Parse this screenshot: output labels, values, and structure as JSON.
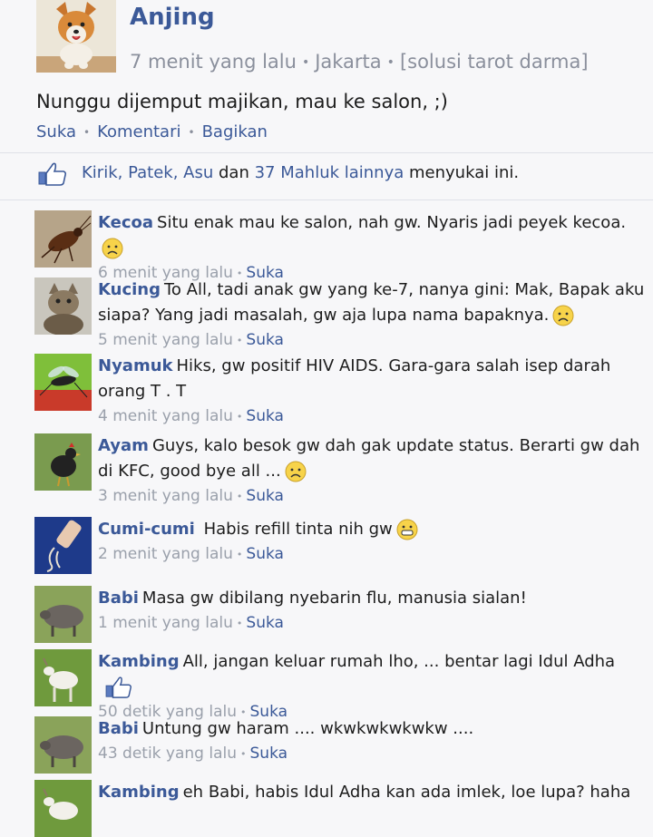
{
  "post": {
    "author": "Anjing",
    "time": "7 menit yang lalu",
    "location": "Jakarta",
    "source": "[solusi tarot darma]",
    "text": "Nunggu dijemput majikan, mau ke salon, ;)",
    "actions": [
      "Suka",
      "Komentari",
      "Bagikan"
    ]
  },
  "likes": {
    "names": "Kirik, Patek, Asu",
    "and": "dan",
    "others": "37 Mahluk lainnya",
    "suffix": "menyukai ini."
  },
  "comments": [
    {
      "name": "Kecoa",
      "text": "Situ enak mau ke salon, nah gw. Nyaris jadi peyek kecoa.",
      "time": "6 menit yang lalu",
      "like": "Suka",
      "emoji": "sad-emoji",
      "avatar": "cockroach-photo"
    },
    {
      "name": "Kucing",
      "text": "To All, tadi anak gw yang ke-7, nanya gini: Mak, Bapak aku siapa? Yang jadi masalah, gw aja lupa nama bapaknya.",
      "time": "5 menit yang lalu",
      "like": "Suka",
      "emoji": "sad-emoji",
      "avatar": "cat-photo"
    },
    {
      "name": "Nyamuk",
      "text": "Hiks, gw positif HIV AIDS. Gara-gara salah isep darah orang T . T",
      "time": "4 menit yang lalu",
      "like": "Suka",
      "emoji": "",
      "avatar": "mosquito-photo"
    },
    {
      "name": "Ayam",
      "text": "Guys, kalo besok gw dah gak update status. Berarti gw dah di KFC, good bye all ...",
      "time": "3 menit yang lalu",
      "like": "Suka",
      "emoji": "sad-emoji",
      "avatar": "chicken-photo"
    },
    {
      "name": "Cumi-cumi",
      "text": " Habis refill tinta nih gw",
      "time": "2 menit yang lalu",
      "like": "Suka",
      "emoji": "grin-emoji",
      "avatar": "squid-photo"
    },
    {
      "name": "Babi",
      "text": "Masa gw dibilang nyebarin flu, manusia sialan!",
      "time": "1 menit yang lalu",
      "like": "Suka",
      "emoji": "",
      "avatar": "pig-photo"
    },
    {
      "name": "Kambing",
      "text": "All, jangan keluar rumah lho, ... bentar lagi Idul Adha",
      "time": "50 detik yang lalu",
      "like": "Suka",
      "emoji": "thumbs-up",
      "avatar": "goat-photo"
    },
    {
      "name": "Babi",
      "text": "Untung gw haram .... wkwkwkwkwkw ....",
      "time": "43 detik yang lalu",
      "like": "Suka",
      "emoji": "",
      "avatar": "pig-photo"
    },
    {
      "name": "Kambing",
      "text": "eh Babi, habis Idul Adha kan ada imlek, loe lupa? haha",
      "time": "",
      "like": "",
      "emoji": "",
      "avatar": "goat-photo"
    }
  ],
  "colors": {
    "link": "#3b5998",
    "meta": "#9aa0ab",
    "background": "#f7f7f9"
  }
}
